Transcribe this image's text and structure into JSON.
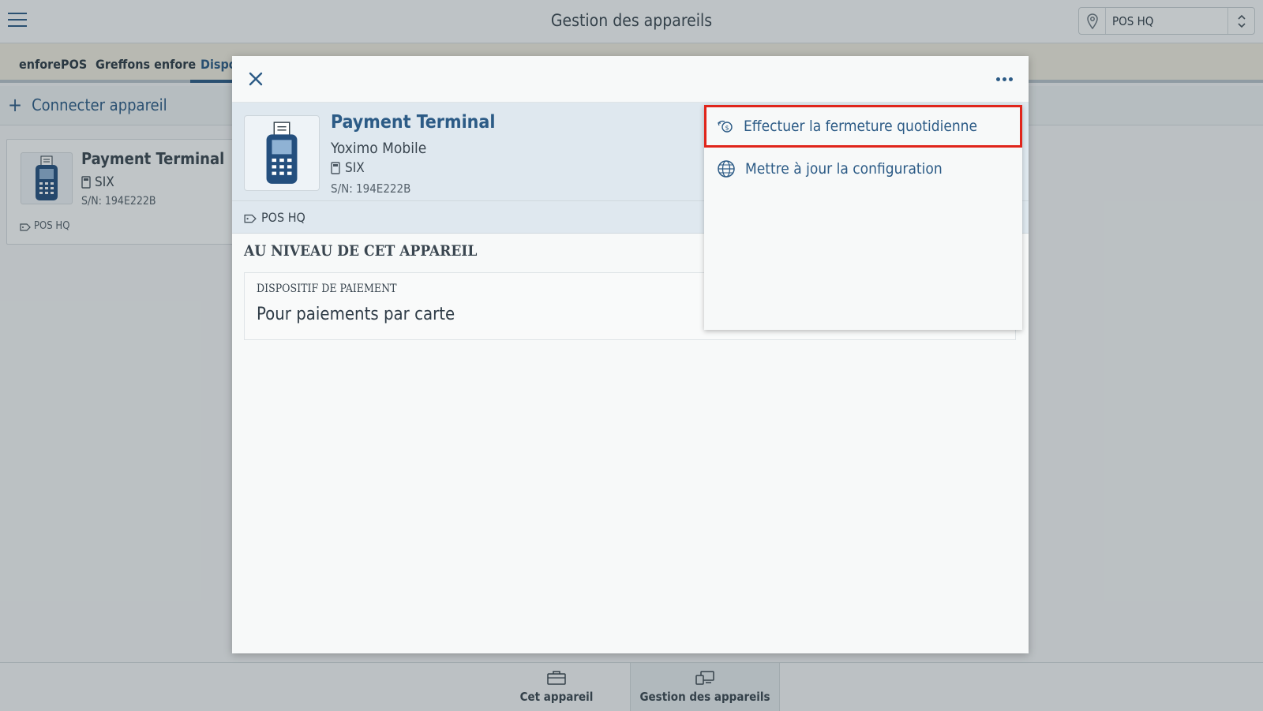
{
  "topbar": {
    "title": "Gestion des appareils",
    "location": "POS HQ"
  },
  "tabs": [
    {
      "label": "enforePOS"
    },
    {
      "label": "Greffons enfore"
    },
    {
      "label": "Dispo"
    }
  ],
  "connect": {
    "label": "Connecter appareil"
  },
  "background_card": {
    "name": "Payment Terminal",
    "brand": "SIX",
    "serial": "S/N: 194E222B",
    "location": "POS HQ"
  },
  "modal": {
    "device": {
      "name": "Payment Terminal",
      "model": "Yoximo Mobile",
      "brand": "SIX",
      "serial": "S/N: 194E222B",
      "location": "POS HQ"
    },
    "section_title": "AU NIVEAU DE CET APPAREIL",
    "info": {
      "label": "DISPOSITIF DE PAIEMENT",
      "value": "Pour paiements par carte"
    }
  },
  "dropdown": {
    "items": [
      {
        "label": "Effectuer la fermeture quotidienne",
        "icon": "cash-hand-icon"
      },
      {
        "label": "Mettre à jour la configuration",
        "icon": "globe-refresh-icon"
      }
    ]
  },
  "bottom_nav": [
    {
      "label": "Cet appareil",
      "icon": "briefcase-icon"
    },
    {
      "label": "Gestion des appareils",
      "icon": "devices-icon"
    }
  ],
  "colors": {
    "accent": "#2c5b86",
    "highlight": "#e0251b"
  }
}
